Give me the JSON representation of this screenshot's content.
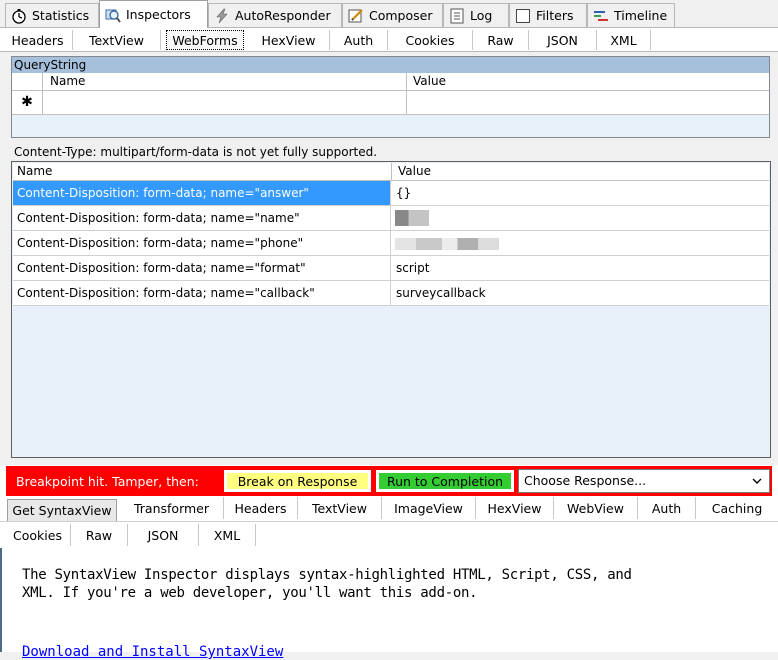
{
  "main_tabs": [
    {
      "label": "Statistics",
      "icon": "stopwatch-icon"
    },
    {
      "label": "Inspectors",
      "icon": "magnifier-icon"
    },
    {
      "label": "AutoResponder",
      "icon": "lightning-icon"
    },
    {
      "label": "Composer",
      "icon": "pencil-icon"
    },
    {
      "label": "Log",
      "icon": "log-icon"
    },
    {
      "label": "Filters",
      "icon": "checkbox-icon"
    },
    {
      "label": "Timeline",
      "icon": "timeline-icon"
    }
  ],
  "request_tabs": [
    "Headers",
    "TextView",
    "WebForms",
    "HexView",
    "Auth",
    "Cookies",
    "Raw",
    "JSON",
    "XML"
  ],
  "querystring": {
    "title": "QueryString",
    "col_name": "Name",
    "col_value": "Value",
    "new_row_marker": "✱"
  },
  "content_type_note": "Content-Type: multipart/form-data is not yet fully supported.",
  "form_grid": {
    "col_name": "Name",
    "col_value": "Value",
    "rows": [
      {
        "name": "Content-Disposition: form-data; name=\"answer\"",
        "value": "{}"
      },
      {
        "name": "Content-Disposition: form-data; name=\"name\"",
        "value": ""
      },
      {
        "name": "Content-Disposition: form-data; name=\"phone\"",
        "value": ""
      },
      {
        "name": "Content-Disposition: form-data; name=\"format\"",
        "value": "script"
      },
      {
        "name": "Content-Disposition: form-data; name=\"callback\"",
        "value": "surveycallback"
      }
    ]
  },
  "breakpoint": {
    "message": "Breakpoint hit. Tamper, then:",
    "break_on_response": "Break on Response",
    "run_to_completion": "Run to Completion",
    "choose_response": "Choose Response...",
    "colors": {
      "bar": "#ff0000",
      "break_btn": "#ffff80",
      "run_btn": "#33cc33"
    }
  },
  "response_tabs_row1": [
    "Get SyntaxView",
    "Transformer",
    "Headers",
    "TextView",
    "ImageView",
    "HexView",
    "WebView",
    "Auth",
    "Caching"
  ],
  "response_tabs_row2": [
    "Cookies",
    "Raw",
    "JSON",
    "XML"
  ],
  "syntaxview": {
    "line1": "The SyntaxView Inspector displays syntax-highlighted HTML, Script, CSS, and",
    "line2": "XML. If you're a web developer, you'll want this add-on.",
    "link": "Download and Install SyntaxView"
  }
}
